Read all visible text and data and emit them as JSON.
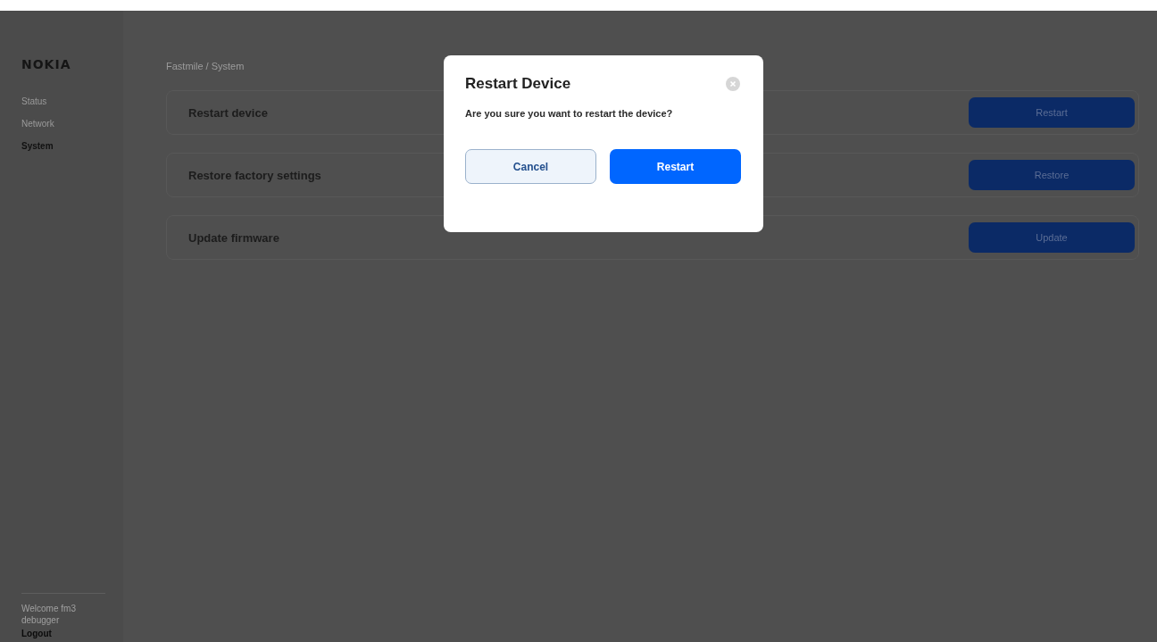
{
  "logo": "NOKIA",
  "sidebar": {
    "items": [
      {
        "label": "Status",
        "selected": false
      },
      {
        "label": "Network",
        "selected": false
      },
      {
        "label": "System",
        "selected": true
      }
    ],
    "welcome": "Welcome fm3 debugger",
    "logout": "Logout"
  },
  "breadcrumb": "Fastmile / System",
  "actions": [
    {
      "title": "Restart device",
      "button": "Restart"
    },
    {
      "title": "Restore factory settings",
      "button": "Restore"
    },
    {
      "title": "Update firmware",
      "button": "Update"
    }
  ],
  "dialog": {
    "title": "Restart Device",
    "message": "Are you sure you want to restart the device?",
    "buttons": [
      {
        "label": "Cancel",
        "kind": "secondary"
      },
      {
        "label": "Restart",
        "kind": "primary"
      }
    ]
  }
}
